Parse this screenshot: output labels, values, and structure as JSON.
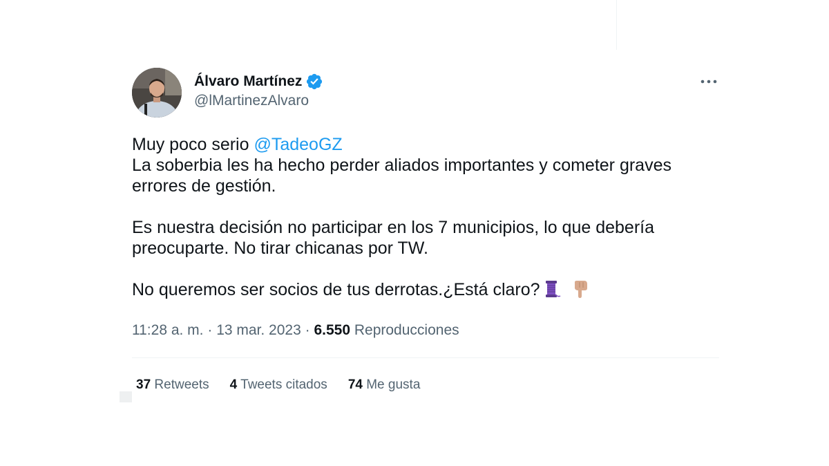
{
  "tweet": {
    "author": {
      "display_name": "Álvaro Martínez",
      "handle": "@lMartinezAlvaro",
      "verified": true,
      "verified_color": "#1d9bf0"
    },
    "more_icon": "ellipsis-icon",
    "text": {
      "line1_prefix": "Muy poco serio ",
      "line1_mention": "@TadeoGZ",
      "line2": "La soberbia les ha hecho perder aliados importantes y cometer graves",
      "line3": "errores de gestión.",
      "line4": "Es nuestra decisión no participar en los 7 municipios, lo que debería",
      "line5": "preocuparte. No tirar chicanas por TW.",
      "line6": "No queremos ser socios de tus derrotas.¿Está claro?",
      "emojis": [
        "spool-of-thread-icon",
        "pointing-down-hand-icon"
      ]
    },
    "meta": {
      "time": "11:28 a. m.",
      "separator": " · ",
      "date": "13 mar. 2023",
      "views_count": "6.550",
      "views_label": "Reproducciones"
    },
    "stats": {
      "retweets_count": "37",
      "retweets_label": "Retweets",
      "quotes_count": "4",
      "quotes_label": "Tweets citados",
      "likes_count": "74",
      "likes_label": "Me gusta"
    }
  },
  "colors": {
    "text_primary": "#0f1419",
    "text_secondary": "#536471",
    "link": "#1d9bf0",
    "divider": "#eff3f4"
  }
}
